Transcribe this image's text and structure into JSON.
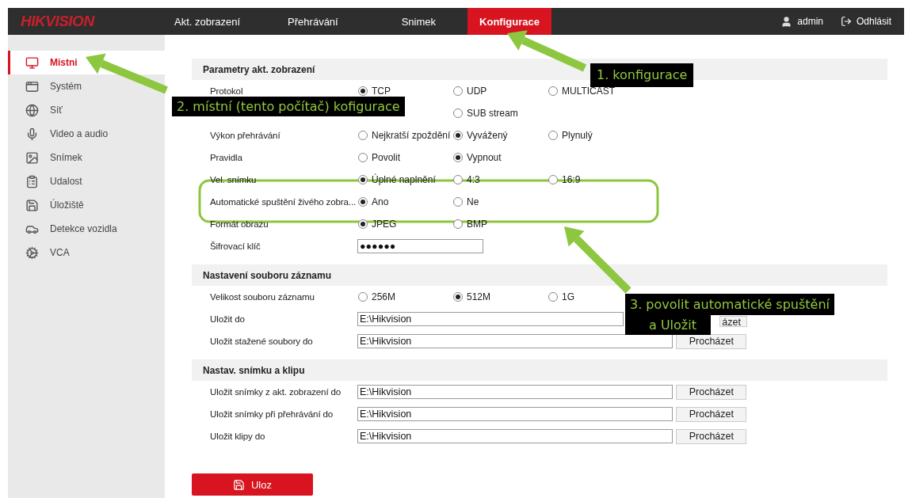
{
  "brand": "HIKVISION",
  "nav": {
    "tabs": [
      {
        "label": "Akt. zobrazení",
        "selected": false
      },
      {
        "label": "Přehrávání",
        "selected": false
      },
      {
        "label": "Snimek",
        "selected": false
      },
      {
        "label": "Konfigurace",
        "selected": true
      }
    ],
    "user": "admin",
    "logout": "Odhlásit"
  },
  "sidebar": {
    "items": [
      {
        "label": "Mistni",
        "selected": true
      },
      {
        "label": "Systém",
        "selected": false
      },
      {
        "label": "Síť",
        "selected": false
      },
      {
        "label": "Video a audio",
        "selected": false
      },
      {
        "label": "Snímek",
        "selected": false
      },
      {
        "label": "Udalost",
        "selected": false
      },
      {
        "label": "Úložiště",
        "selected": false
      },
      {
        "label": "Detekce vozidla",
        "selected": false
      },
      {
        "label": "VCA",
        "selected": false
      }
    ]
  },
  "sections": [
    {
      "title": "Parametry akt. zobrazení",
      "rows": [
        {
          "kind": "radio",
          "label": "Protokol",
          "options": [
            {
              "kind": "option",
              "label": "TCP",
              "selected": true
            },
            {
              "kind": "option",
              "label": "UDP",
              "selected": false
            },
            {
              "kind": "option",
              "label": "MULTICAST",
              "selected": false
            }
          ]
        },
        {
          "kind": "radio",
          "options": [
            {
              "kind": "covered"
            },
            {
              "kind": "option",
              "label": "SUB stream",
              "selected": false
            }
          ]
        },
        {
          "kind": "radio",
          "label": "Výkon přehrávání",
          "options": [
            {
              "kind": "option",
              "label": "Nejkratší zpoždění",
              "selected": false
            },
            {
              "kind": "option",
              "label": "Vyvážený",
              "selected": true
            },
            {
              "kind": "option",
              "label": "Plynulý",
              "selected": false
            }
          ]
        },
        {
          "kind": "radio",
          "label": "Pravidla",
          "options": [
            {
              "kind": "option",
              "label": "Povolit",
              "selected": false
            },
            {
              "kind": "option",
              "label": "Vypnout",
              "selected": true
            }
          ]
        },
        {
          "kind": "radio",
          "label": "Vel. snímku",
          "options": [
            {
              "kind": "option",
              "label": "Úplné naplnění",
              "selected": true
            },
            {
              "kind": "option",
              "label": "4:3",
              "selected": false
            },
            {
              "kind": "option",
              "label": "16:9",
              "selected": false
            }
          ]
        },
        {
          "kind": "radio",
          "label": "Automatické spuštění živého zobra...",
          "options": [
            {
              "kind": "option",
              "label": "Ano",
              "selected": true
            },
            {
              "kind": "option",
              "label": "Ne",
              "selected": false
            }
          ]
        },
        {
          "kind": "radio",
          "label": "Formát obrazu",
          "options": [
            {
              "kind": "option",
              "label": "JPEG",
              "selected": true
            },
            {
              "kind": "option",
              "label": "BMP",
              "selected": false
            }
          ]
        },
        {
          "kind": "secret",
          "label": "Šifrovací klíč",
          "value": "●●●●●●"
        }
      ]
    },
    {
      "title": "Nastavení souboru záznamu",
      "rows": [
        {
          "kind": "radio",
          "label": "Velikost souboru záznamu",
          "options": [
            {
              "kind": "option",
              "label": "256M",
              "selected": false
            },
            {
              "kind": "option",
              "label": "512M",
              "selected": true
            },
            {
              "kind": "option",
              "label": "1G",
              "selected": false
            }
          ]
        },
        {
          "kind": "path",
          "label": "Uložit do",
          "value": "E:\\Hikvision",
          "button": "ázet"
        },
        {
          "kind": "path",
          "label": "Uložit stažené soubory do",
          "value": "E:\\Hikvision",
          "button": "Procházet"
        }
      ]
    },
    {
      "title": "Nastav. snímku a klipu",
      "rows": [
        {
          "kind": "path",
          "label": "Uložit snímky z akt. zobrazení do",
          "value": "E:\\Hikvision",
          "button": "Procházet"
        },
        {
          "kind": "path",
          "label": "Uložit snímky při přehrávání do",
          "value": "E:\\Hikvision",
          "button": "Procházet"
        },
        {
          "kind": "path",
          "label": "Uložit klipy do",
          "value": "E:\\Hikvision",
          "button": "Procházet"
        }
      ]
    }
  ],
  "save_button": "Uloz",
  "annotations": [
    {
      "text": "1. konfigurace"
    },
    {
      "text": "2. místní (tento počítač) kofigurace"
    },
    {
      "text": "3. povolit automatické spuštění"
    },
    {
      "text": "a Uložit"
    }
  ]
}
